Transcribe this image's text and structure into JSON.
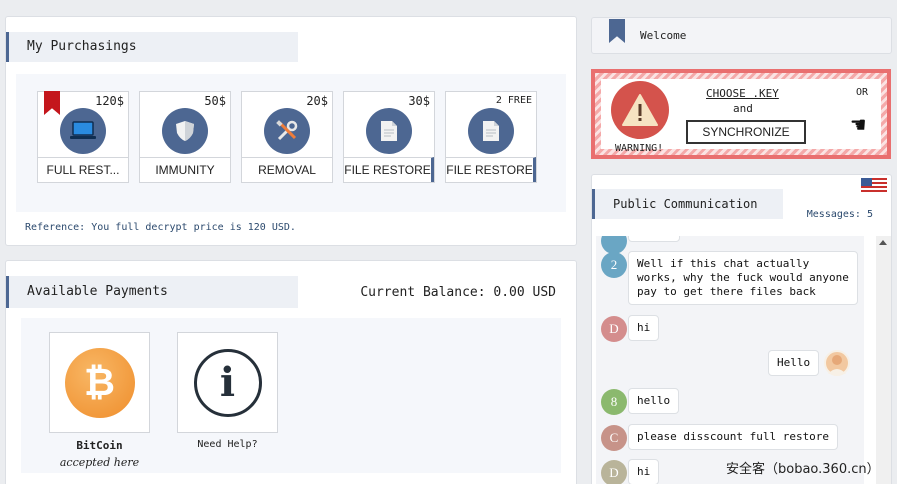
{
  "purchasing": {
    "title": "My Purchasings",
    "cards": [
      {
        "price": "120$",
        "label": "FULL REST...",
        "icon": "laptop-icon"
      },
      {
        "price": "50$",
        "label": "IMMUNITY",
        "icon": "shield-icon"
      },
      {
        "price": "20$",
        "label": "REMOVAL",
        "icon": "tools-icon"
      },
      {
        "price": "30$",
        "label": "FILE RESTORE",
        "icon": "file-icon"
      },
      {
        "price": "2 FREE",
        "label": "FILE RESTORE",
        "icon": "file-icon"
      }
    ],
    "reference": "Reference: You full decrypt price is 120 USD."
  },
  "payments": {
    "title": "Available Payments",
    "balance": "Current Balance: 0.00 USD",
    "methods": [
      {
        "name": "BitCoin",
        "sub": "accepted here",
        "icon": "bitcoin-icon"
      },
      {
        "name": "Need Help?",
        "icon": "info-icon"
      }
    ]
  },
  "welcome": {
    "title": "Welcome",
    "warning_label": "WARNING!",
    "choose_label": "CHOOSE .KEY",
    "and_label": "and",
    "sync_button": "SYNCHRONIZE",
    "or_label": "OR"
  },
  "chat": {
    "title": "Public Communication",
    "messages_count": "Messages: 5",
    "messages": [
      {
        "avatar": "2",
        "color": "#6aa6c4",
        "text": "Well if this chat actually works, why the fuck would anyone pay to get there files back"
      },
      {
        "avatar": "D",
        "color": "#d48d8d",
        "text": "hi"
      },
      {
        "avatar": "",
        "color": "#f2c8a0",
        "text": "Hello",
        "self": true
      },
      {
        "avatar": "8",
        "color": "#8bb96e",
        "text": "hello"
      },
      {
        "avatar": "C",
        "color": "#c79389",
        "text": "please disscount full restore"
      },
      {
        "avatar": "D",
        "color": "#b9b49a",
        "text": "hi"
      }
    ]
  },
  "watermark": "安全客（bobao.360.cn）",
  "colors": {
    "accent": "#4d6792",
    "warning": "#d4534c",
    "bitcoin": "#f39a3b"
  }
}
